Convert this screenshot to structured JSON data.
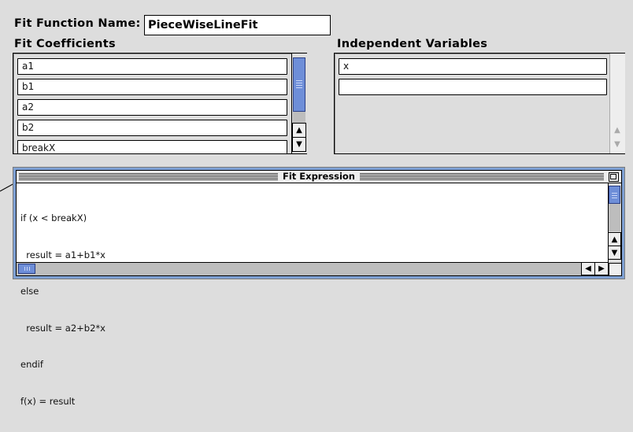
{
  "function_name": {
    "label": "Fit Function Name:",
    "value": "PieceWiseLineFit"
  },
  "coefficients": {
    "label": "Fit Coefficients",
    "items": [
      "a1",
      "b1",
      "a2",
      "b2",
      "breakX"
    ]
  },
  "independent_vars": {
    "label": "Independent Variables",
    "items": [
      "x",
      ""
    ]
  },
  "expression": {
    "title": "Fit Expression",
    "lines": [
      "if (x < breakX)",
      "  result = a1+b1*x",
      "else",
      "  result = a2+b2*x",
      "endif",
      "f(x) = result"
    ]
  },
  "icons": {
    "scroll_up": "▲",
    "scroll_down": "▼",
    "scroll_left": "◀",
    "scroll_right": "▶"
  },
  "colors": {
    "scroll_thumb": "#6e8ed8",
    "window_frame": "#7fa1d4"
  }
}
